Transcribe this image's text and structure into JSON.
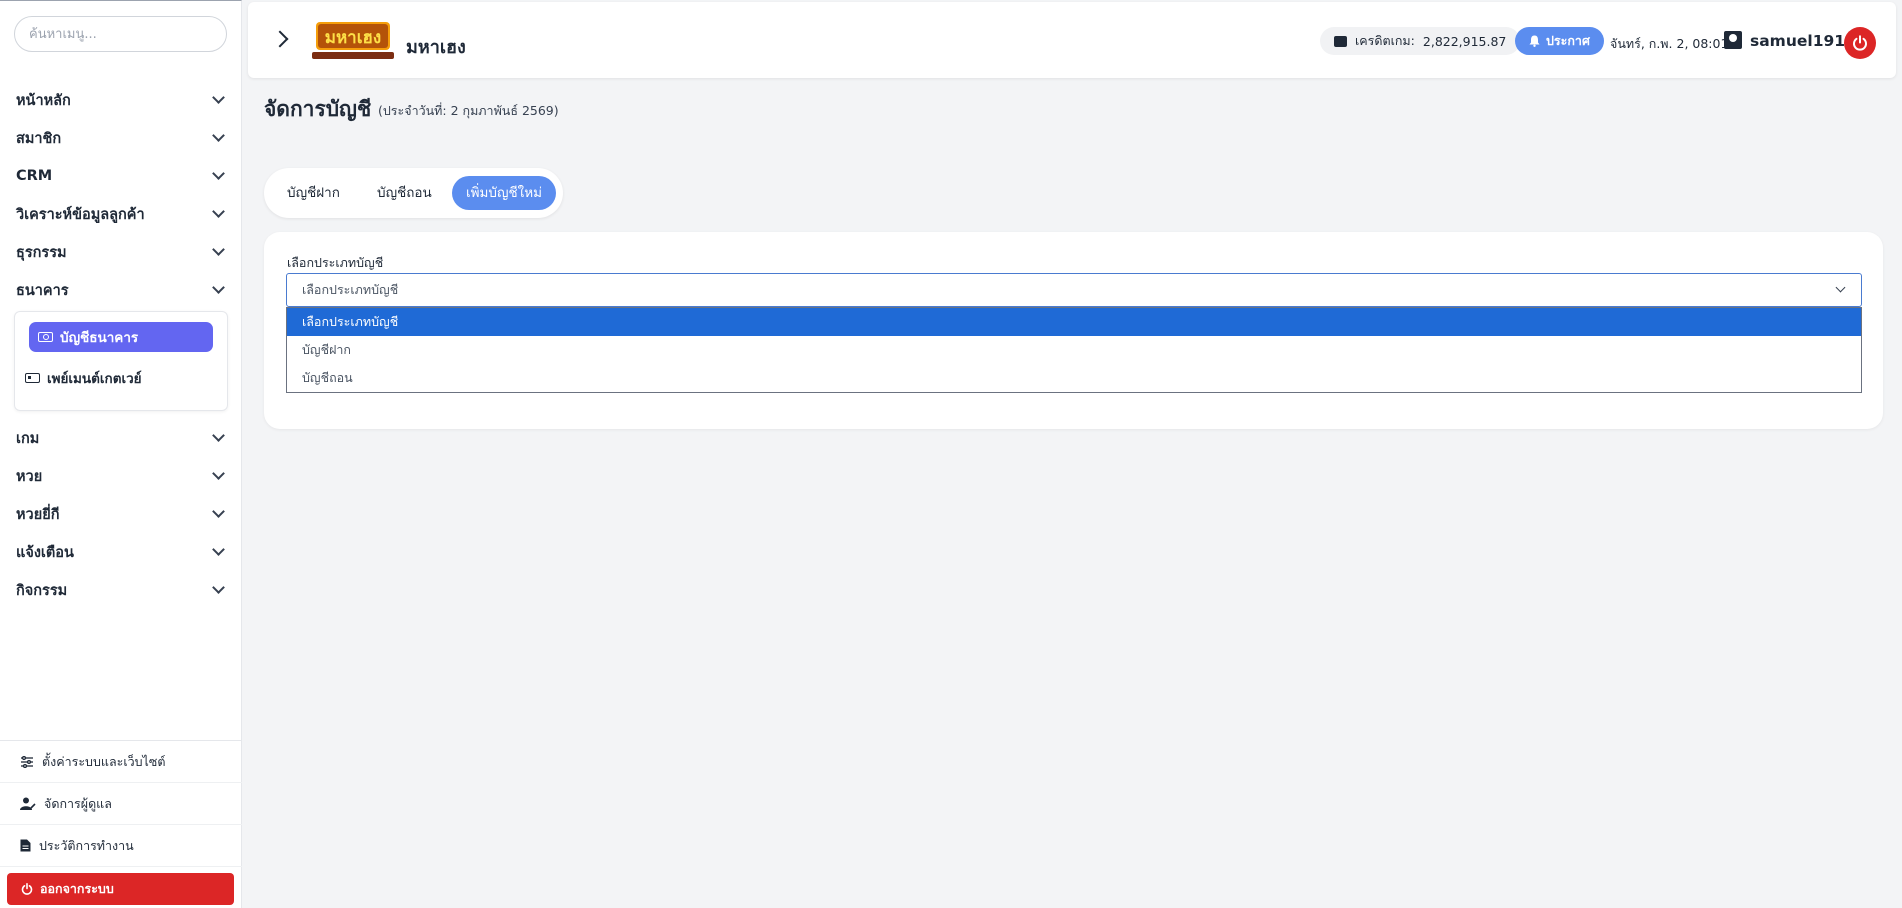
{
  "search": {
    "placeholder": "ค้นหาเมนู..."
  },
  "sidebar": {
    "items": [
      {
        "label": "หน้าหลัก"
      },
      {
        "label": "สมาชิก"
      },
      {
        "label": "CRM"
      },
      {
        "label": "วิเคราะห์ข้อมูลลูกค้า"
      },
      {
        "label": "ธุรกรรม"
      },
      {
        "label": "ธนาคาร"
      },
      {
        "label": "เกม"
      },
      {
        "label": "หวย"
      },
      {
        "label": "หวยยี่กี"
      },
      {
        "label": "แจ้งเตือน"
      },
      {
        "label": "กิจกรรม"
      }
    ],
    "bank_submenu": [
      {
        "label": "บัญชีธนาคาร",
        "icon": "banknote-icon"
      },
      {
        "label": "เพย์เมนต์เกตเวย์",
        "icon": "id-card-icon"
      }
    ],
    "bottom": [
      {
        "label": "ตั้งค่าระบบและเว็บไซต์",
        "icon": "sliders-icon"
      },
      {
        "label": "จัดการผู้ดูแล",
        "icon": "user-edit-icon"
      },
      {
        "label": "ประวัติการทำงาน",
        "icon": "file-icon"
      }
    ],
    "logout_label": "ออกจากระบบ"
  },
  "header": {
    "brand": "มหาเฮง",
    "logo_text": "มหาเฮง",
    "credit_label": "เครดิตเกม:",
    "credit_value": "2,822,915.87",
    "announce_label": "ประกาศ",
    "datetime": "จันทร์, ก.พ. 2, 08:01",
    "username": "samuel191s"
  },
  "page": {
    "title": "จัดการบัญชี",
    "subtitle": "(ประจำวันที่: 2 กุมภาพันธ์ 2569)"
  },
  "tabs": [
    {
      "label": "บัญชีฝาก"
    },
    {
      "label": "บัญชีถอน"
    },
    {
      "label": "เพิ่มบัญชีใหม่"
    }
  ],
  "form": {
    "field_label": "เลือกประเภทบัญชี",
    "selected": "เลือกประเภทบัญชี",
    "options": [
      {
        "label": "เลือกประเภทบัญชี"
      },
      {
        "label": "บัญชีฝาก"
      },
      {
        "label": "บัญชีถอน"
      }
    ]
  },
  "colors": {
    "accent": "#5b8def",
    "active_menu": "#6366f1",
    "danger": "#dc2626",
    "option_highlight": "#1f6ad6"
  }
}
